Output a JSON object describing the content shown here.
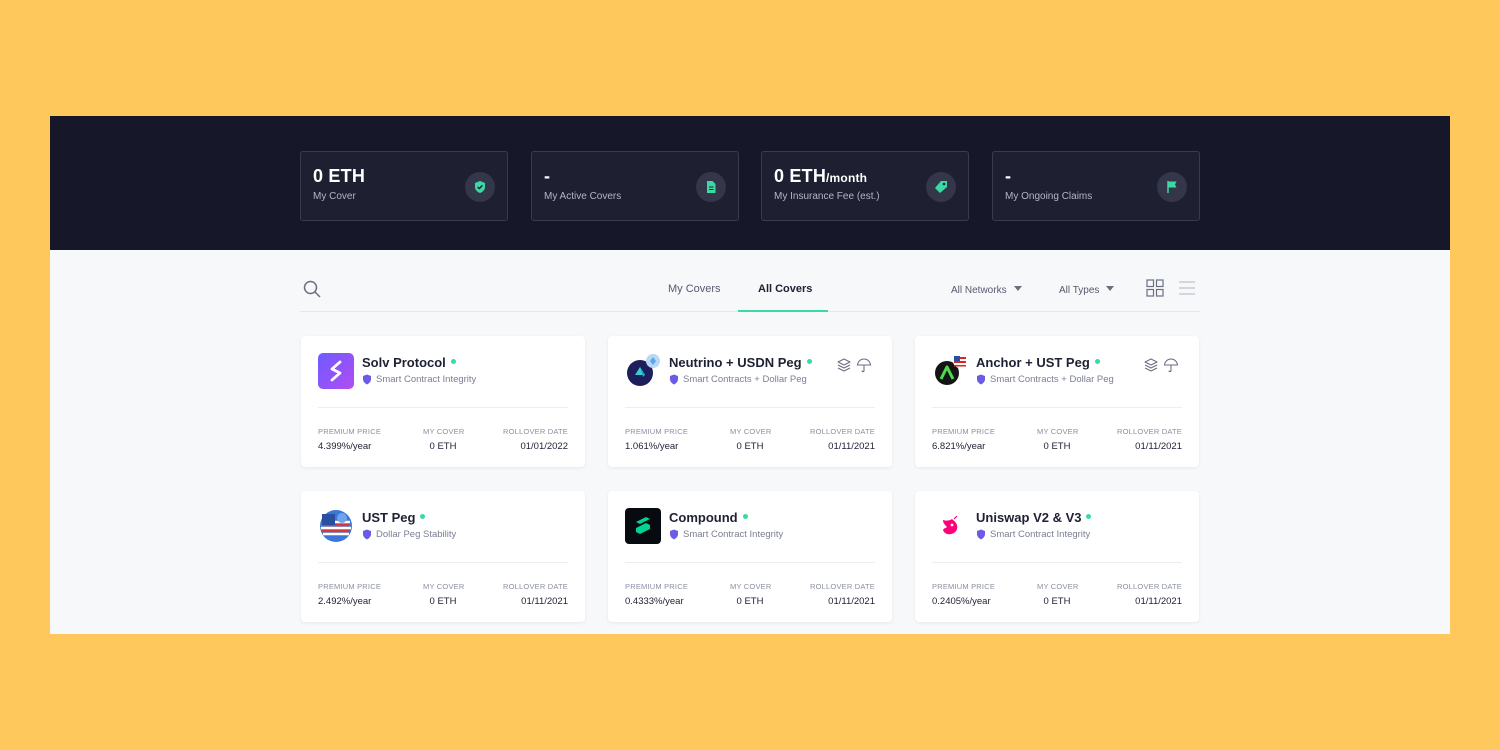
{
  "colors": {
    "background": "#FFC85D",
    "hero": "#161729",
    "accent": "#3DD9A4",
    "shield": "#6B5CE7"
  },
  "stats": [
    {
      "value": "0 ETH",
      "suffix": "",
      "label": "My Cover",
      "icon": "shield-check-icon"
    },
    {
      "value": "-",
      "suffix": "",
      "label": "My Active Covers",
      "icon": "document-icon"
    },
    {
      "value": "0 ETH",
      "suffix": "/month",
      "label": "My Insurance Fee (est.)",
      "icon": "tag-icon"
    },
    {
      "value": "-",
      "suffix": "",
      "label": "My Ongoing Claims",
      "icon": "flag-icon"
    }
  ],
  "toolbar": {
    "tabs": [
      {
        "label": "My Covers"
      },
      {
        "label": "All Covers"
      }
    ],
    "active_tab": "All Covers",
    "network_filter": "All Networks",
    "type_filter": "All Types"
  },
  "columns": {
    "premium": "PREMIUM PRICE",
    "cover": "MY COVER",
    "rollover": "ROLLOVER DATE"
  },
  "cards": [
    {
      "name": "Solv Protocol",
      "type": "Smart Contract Integrity",
      "premium": "4.399%/year",
      "cover": "0 ETH",
      "rollover": "01/01/2022",
      "logo": "solv-logo"
    },
    {
      "name": "Neutrino + USDN Peg",
      "type": "Smart Contracts + Dollar Peg",
      "premium": "1.061%/year",
      "cover": "0 ETH",
      "rollover": "01/11/2021",
      "logo": "neutrino-logo"
    },
    {
      "name": "Anchor + UST Peg",
      "type": "Smart Contracts + Dollar Peg",
      "premium": "6.821%/year",
      "cover": "0 ETH",
      "rollover": "01/11/2021",
      "logo": "anchor-logo"
    },
    {
      "name": "UST Peg",
      "type": "Dollar Peg Stability",
      "premium": "2.492%/year",
      "cover": "0 ETH",
      "rollover": "01/11/2021",
      "logo": "ust-logo"
    },
    {
      "name": "Compound",
      "type": "Smart Contract Integrity",
      "premium": "0.4333%/year",
      "cover": "0 ETH",
      "rollover": "01/11/2021",
      "logo": "compound-logo"
    },
    {
      "name": "Uniswap V2 & V3",
      "type": "Smart Contract Integrity",
      "premium": "0.2405%/year",
      "cover": "0 ETH",
      "rollover": "01/11/2021",
      "logo": "uniswap-logo"
    }
  ]
}
